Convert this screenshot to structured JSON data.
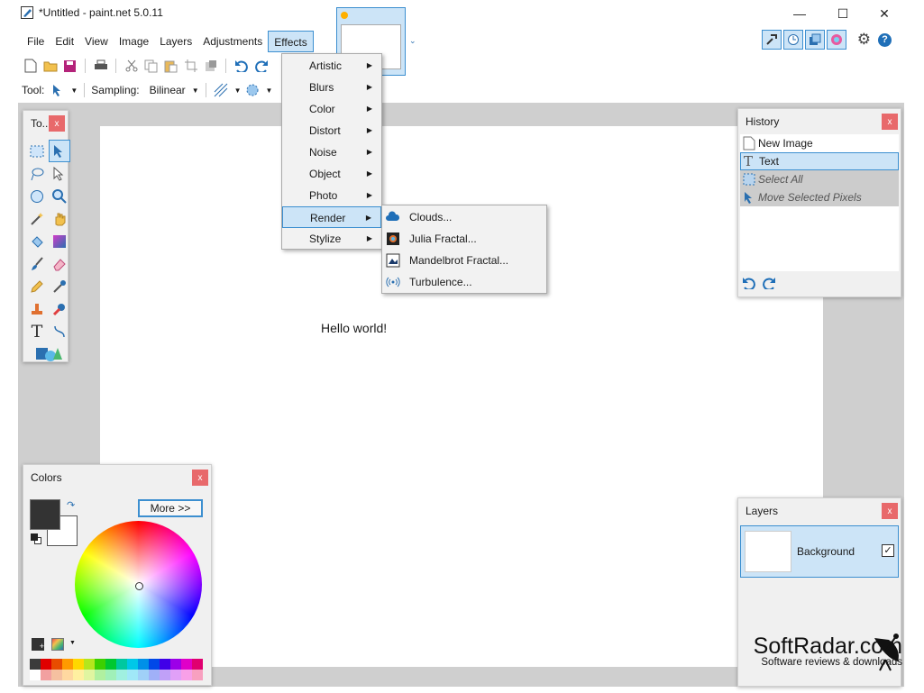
{
  "window": {
    "title": "*Untitled - paint.net 5.0.11"
  },
  "menu": [
    "File",
    "Edit",
    "View",
    "Image",
    "Layers",
    "Adjustments",
    "Effects"
  ],
  "toolbar2": {
    "tool_label": "Tool:",
    "sampling_label": "Sampling:",
    "sampling_value": "Bilinear"
  },
  "effects_menu": [
    "Artistic",
    "Blurs",
    "Color",
    "Distort",
    "Noise",
    "Object",
    "Photo",
    "Render",
    "Stylize"
  ],
  "render_submenu": [
    "Clouds...",
    "Julia Fractal...",
    "Mandelbrot Fractal...",
    "Turbulence..."
  ],
  "canvas": {
    "text": "Hello world!"
  },
  "tools_panel": {
    "title": "To..."
  },
  "history": {
    "title": "History",
    "items": [
      "New Image",
      "Text",
      "Select All",
      "Move Selected Pixels"
    ]
  },
  "colors": {
    "title": "Colors",
    "more": "More >>"
  },
  "layers": {
    "title": "Layers",
    "items": [
      "Background"
    ]
  },
  "watermark": {
    "main": "SoftRadar.com",
    "sub": "Software reviews & downloads"
  },
  "palette": [
    "#3b3b3b",
    "#e00000",
    "#e84c00",
    "#ff9b00",
    "#ffd800",
    "#b5e61d",
    "#3cd000",
    "#00c830",
    "#00c8a0",
    "#00c8e8",
    "#0090e8",
    "#0048e8",
    "#4000e8",
    "#9c00e8",
    "#e000c8",
    "#e00070",
    "#ffffff",
    "#f2a0a0",
    "#f5c0a0",
    "#ffd8a0",
    "#fff0a0",
    "#e0f5a0",
    "#b0f0a0",
    "#a0f0b8",
    "#a0f0e0",
    "#a0e8f8",
    "#a0d0f8",
    "#a0b0f8",
    "#c0a0f8",
    "#e0a0f8",
    "#f8a0e8",
    "#f8a0c0"
  ]
}
